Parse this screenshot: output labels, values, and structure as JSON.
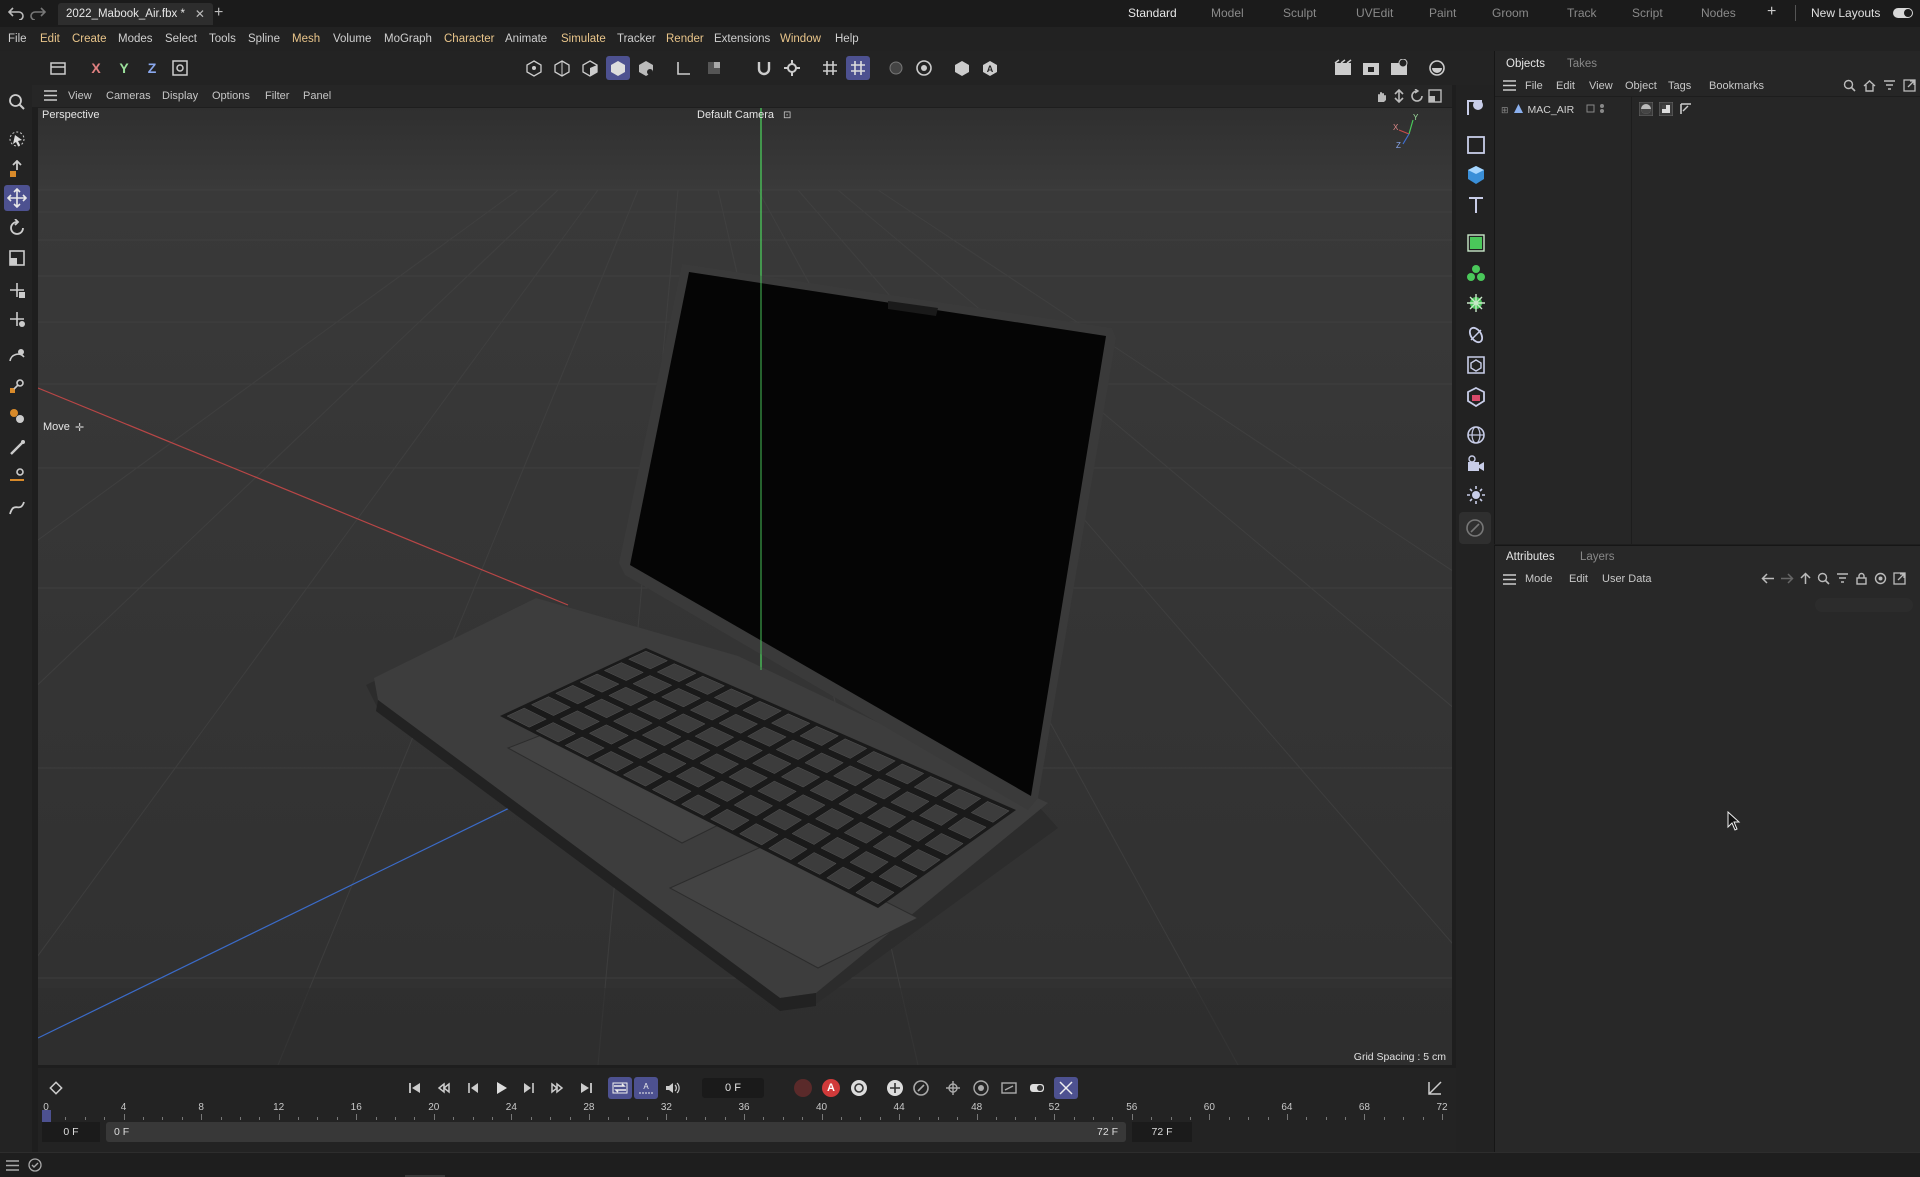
{
  "titlebar": {
    "doc_name": "2022_Mabook_Air.fbx *",
    "layouts": [
      "Standard",
      "Model",
      "Sculpt",
      "UVEdit",
      "Paint",
      "Groom",
      "Track",
      "Script",
      "Nodes"
    ],
    "active_layout": "Standard",
    "new_layouts": "New Layouts"
  },
  "menu": [
    "File",
    "Edit",
    "Create",
    "Modes",
    "Select",
    "Tools",
    "Spline",
    "Mesh",
    "Volume",
    "MoGraph",
    "Character",
    "Animate",
    "Simulate",
    "Tracker",
    "Render",
    "Extensions",
    "Window",
    "Help"
  ],
  "toolbar": {
    "axis_x": "X",
    "axis_y": "Y",
    "axis_z": "Z"
  },
  "viewport": {
    "menu": [
      "View",
      "Cameras",
      "Display",
      "Options",
      "Filter",
      "Panel"
    ],
    "label": "Perspective",
    "camera": "Default Camera",
    "tool_label": "Move",
    "grid_spacing": "Grid Spacing : 5 cm",
    "axis_x": "X",
    "axis_y": "Y",
    "axis_z": "Z"
  },
  "objects_panel": {
    "tabs": [
      "Objects",
      "Takes"
    ],
    "menu": [
      "File",
      "Edit",
      "View",
      "Object",
      "Tags",
      "Bookmarks"
    ],
    "items": [
      {
        "name": "MAC_AIR"
      }
    ]
  },
  "attributes_panel": {
    "tabs": [
      "Attributes",
      "Layers"
    ],
    "menu": [
      "Mode",
      "Edit",
      "User Data"
    ]
  },
  "timeline": {
    "current_frame": "0 F",
    "ticks": [
      "0",
      "4",
      "8",
      "12",
      "16",
      "20",
      "24",
      "28",
      "32",
      "36",
      "40",
      "44",
      "48",
      "52",
      "56",
      "60",
      "64",
      "68",
      "72"
    ],
    "start_field": "0 F",
    "range_start": "0 F",
    "range_end": "72 F",
    "end_field": "72 F"
  },
  "colors": {
    "accent": "#4d5190",
    "menu_highlight": "#e9c58a",
    "axis_x": "#c84a4a",
    "axis_y": "#4ac85a",
    "axis_z": "#3f6fd0",
    "record": "#d03a3a"
  }
}
